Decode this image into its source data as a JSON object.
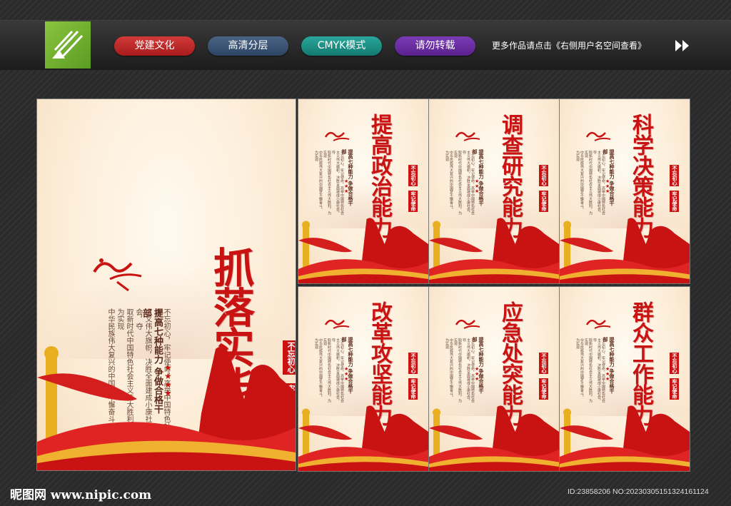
{
  "header": {
    "tags": [
      "党建文化",
      "高清分层",
      "CMYK模式",
      "请勿转载"
    ],
    "more_text": "更多作品请点击《右侧用户名空间查看》"
  },
  "big_poster": {
    "title": "抓落实能力",
    "motto": [
      "不忘初心",
      "牢记使命"
    ],
    "slogan": "提高七种能力 争做合格干部",
    "body": [
      "不忘初心，牢记使命，高举中国特色社会",
      "主义伟大旗帜，决胜全面建成小康社会，夺",
      "取新时代中国特色社会主义伟大胜利，为实现",
      "中华民族伟大复兴的中国梦不懈奋斗。"
    ]
  },
  "small_posters": [
    {
      "title": "提高政治能力"
    },
    {
      "title": "调查研究能力"
    },
    {
      "title": "科学决策能力"
    },
    {
      "title": "改革攻坚能力"
    },
    {
      "title": "应急处突能力"
    },
    {
      "title": "群众工作能力"
    }
  ],
  "small_common": {
    "motto": [
      "不忘初心",
      "牢记使命"
    ],
    "slogan": "提高七种能力 争做合格干部",
    "body": [
      "不忘初心，牢记使命，高举中国特色社会",
      "主义伟大旗帜，决胜全面建成小康社会，夺",
      "取新时代中国特色社会主义伟大胜利，为实现",
      "中华民族伟大复兴的中国梦不懈奋斗。",
      "为实现"
    ]
  },
  "footer": {
    "left": "昵图网 www.nipic.com",
    "right": "ID:23858206 NO:20230305151324161124"
  },
  "colors": {
    "primary_red": "#c91313",
    "gold": "#e8b020",
    "cream": "#fcecd6"
  }
}
